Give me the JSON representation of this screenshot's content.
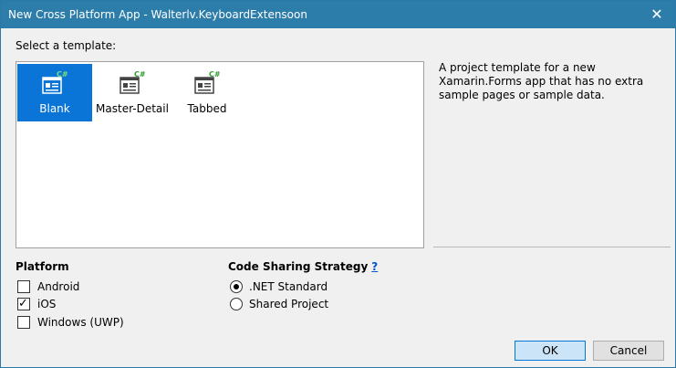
{
  "window": {
    "title": "New Cross Platform App - Walterlv.KeyboardExtensoon",
    "close_glyph": "✕"
  },
  "template_section": {
    "label": "Select a template:",
    "templates": [
      {
        "label": "Blank",
        "icon": "csharp-page-template-icon",
        "selected": true
      },
      {
        "label": "Master-Detail",
        "icon": "csharp-page-template-icon",
        "selected": false
      },
      {
        "label": "Tabbed",
        "icon": "csharp-page-template-icon",
        "selected": false
      }
    ],
    "description": "A project template for a new Xamarin.Forms app that has no extra sample pages or sample data."
  },
  "platform": {
    "heading": "Platform",
    "options": [
      {
        "label": "Android",
        "checked": false
      },
      {
        "label": "iOS",
        "checked": true
      },
      {
        "label": "Windows (UWP)",
        "checked": false
      }
    ]
  },
  "code_sharing": {
    "heading": "Code Sharing Strategy",
    "help_label": "?",
    "options": [
      {
        "label": ".NET Standard",
        "selected": true
      },
      {
        "label": "Shared Project",
        "selected": false
      }
    ]
  },
  "buttons": {
    "ok": "OK",
    "cancel": "Cancel"
  },
  "colors": {
    "titlebar": "#2d7dab",
    "selection": "#0a75d6",
    "csharp_green": "#2e9a2e"
  }
}
